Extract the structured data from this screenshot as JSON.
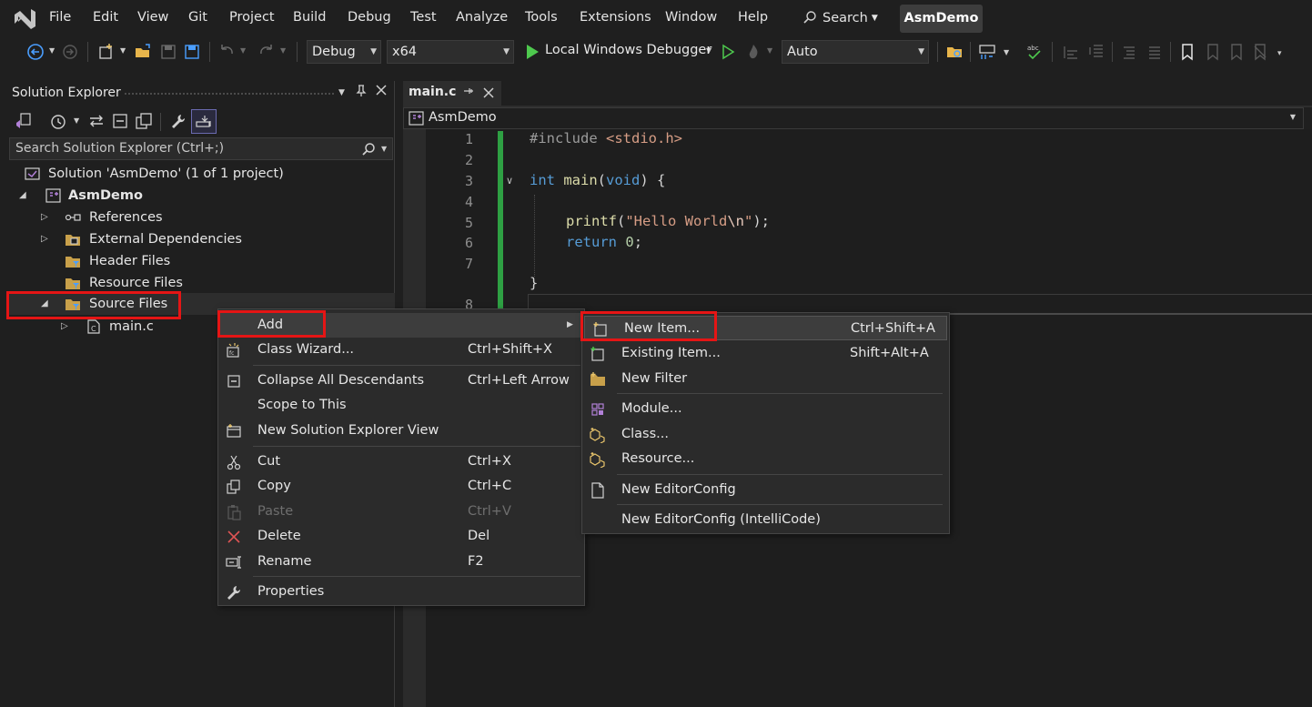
{
  "menubar": {
    "items": [
      "File",
      "Edit",
      "View",
      "Git",
      "Project",
      "Build",
      "Debug",
      "Test",
      "Analyze",
      "Tools",
      "Extensions",
      "Window",
      "Help"
    ],
    "search_label": "Search",
    "solution_name": "AsmDemo"
  },
  "toolbar": {
    "configuration": "Debug",
    "platform": "x64",
    "debugger": "Local Windows Debugger",
    "scope": "Auto"
  },
  "solution_explorer": {
    "title": "Solution Explorer",
    "search_placeholder": "Search Solution Explorer (Ctrl+;)",
    "tree": {
      "solution": "Solution 'AsmDemo' (1 of 1 project)",
      "project": "AsmDemo",
      "references": "References",
      "external_dependencies": "External Dependencies",
      "header_files": "Header Files",
      "resource_files": "Resource Files",
      "source_files": "Source Files",
      "main_file": "main.c"
    }
  },
  "editor": {
    "tab_label": "main.c",
    "nav_scope": "AsmDemo",
    "line_numbers": [
      "1",
      "2",
      "3",
      "4",
      "5",
      "6",
      "7",
      "8"
    ],
    "code": {
      "l1_directive": "#include",
      "l1_header": "<stdio.h>",
      "l3_type": "int",
      "l3_name": "main",
      "l3_open": "(",
      "l3_param": "void",
      "l3_close": ") {",
      "l5_fn": "printf",
      "l5_open": "(",
      "l5_str": "\"Hello World",
      "l5_esc": "\\n",
      "l5_strend": "\"",
      "l5_close": ");",
      "l6_kw": "return",
      "l6_num": "0",
      "l6_semi": ";",
      "l8_brace": "}"
    }
  },
  "context_menu": {
    "items": [
      {
        "label": "Add",
        "shortcut": ""
      },
      {
        "label": "Class Wizard...",
        "shortcut": "Ctrl+Shift+X"
      },
      {
        "label": "Collapse All Descendants",
        "shortcut": "Ctrl+Left Arrow"
      },
      {
        "label": "Scope to This",
        "shortcut": ""
      },
      {
        "label": "New Solution Explorer View",
        "shortcut": ""
      },
      {
        "label": "Cut",
        "shortcut": "Ctrl+X"
      },
      {
        "label": "Copy",
        "shortcut": "Ctrl+C"
      },
      {
        "label": "Paste",
        "shortcut": "Ctrl+V"
      },
      {
        "label": "Delete",
        "shortcut": "Del"
      },
      {
        "label": "Rename",
        "shortcut": "F2"
      },
      {
        "label": "Properties",
        "shortcut": ""
      }
    ]
  },
  "add_submenu": {
    "items": [
      {
        "label": "New Item...",
        "shortcut": "Ctrl+Shift+A"
      },
      {
        "label": "Existing Item...",
        "shortcut": "Shift+Alt+A"
      },
      {
        "label": "New Filter",
        "shortcut": ""
      },
      {
        "label": "Module...",
        "shortcut": ""
      },
      {
        "label": "Class...",
        "shortcut": ""
      },
      {
        "label": "Resource...",
        "shortcut": ""
      },
      {
        "label": "New EditorConfig",
        "shortcut": ""
      },
      {
        "label": "New EditorConfig (IntelliCode)",
        "shortcut": ""
      }
    ]
  },
  "colors": {
    "highlight": "#e51515",
    "accent_purple": "#b180d7",
    "run_green": "#4ec94e",
    "change_bar": "#2ea043"
  }
}
